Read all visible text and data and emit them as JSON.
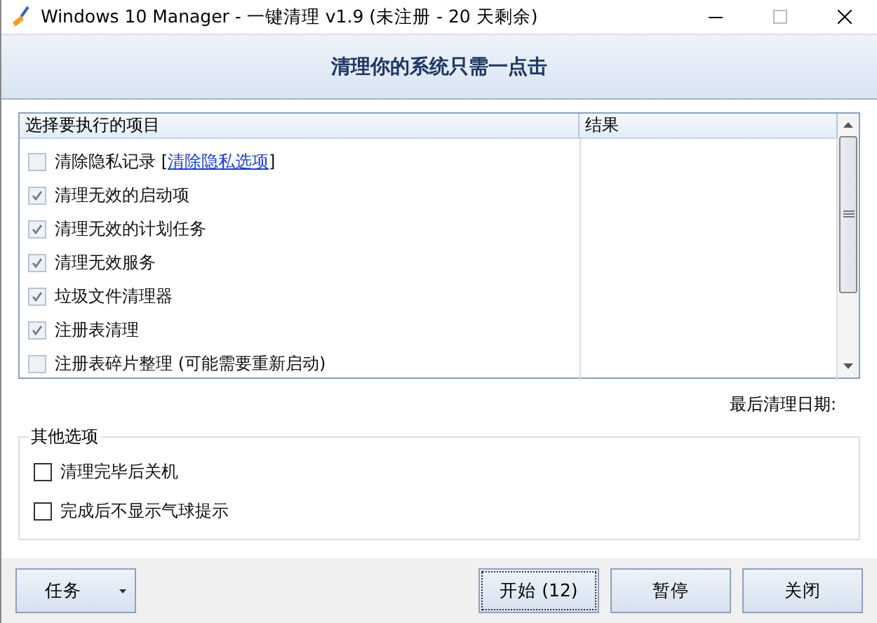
{
  "window": {
    "title": "Windows 10 Manager - 一键清理 v1.9 (未注册 - 20 天剩余)",
    "maximize_disabled": true
  },
  "header": {
    "title": "清理你的系统只需一点击"
  },
  "task_list": {
    "columns": [
      "选择要执行的项目",
      "结果"
    ],
    "items": [
      {
        "label": "清除隐私记录 [",
        "link": "清除隐私选项",
        "label_end": "]",
        "checked": false
      },
      {
        "label": "清理无效的启动项",
        "checked": true
      },
      {
        "label": "清理无效的计划任务",
        "checked": true
      },
      {
        "label": "清理无效服务",
        "checked": true
      },
      {
        "label": "垃圾文件清理器",
        "checked": true
      },
      {
        "label": "注册表清理",
        "checked": true
      },
      {
        "label": "注册表碎片整理 (可能需要重新启动)",
        "checked": false
      }
    ]
  },
  "last_clean_label": "最后清理日期:",
  "other_options": {
    "title": "其他选项",
    "options": [
      {
        "label": "清理完毕后关机",
        "checked": false
      },
      {
        "label": "完成后不显示气球提示",
        "checked": false
      }
    ]
  },
  "buttons": {
    "tasks": "任务",
    "start": "开始 (12)",
    "pause": "暂停",
    "close": "关闭"
  }
}
